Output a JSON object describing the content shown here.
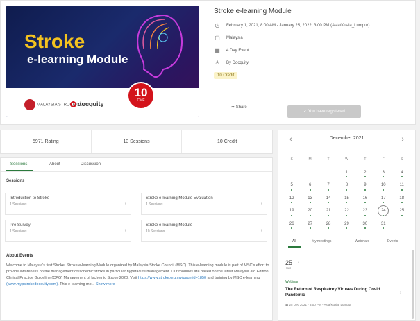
{
  "event": {
    "banner_title": "Stroke",
    "banner_subtitle": "e-learning Module",
    "banner_credit_number": "10",
    "banner_credit_unit": "CME",
    "banner_org": "MALAYSIA STROKE COUNCIL",
    "banner_partner": "docquity",
    "title": "Stroke e-learning Module",
    "date": "February 1, 2021, 8:00 AM - January 25, 2022, 3:00 PM (Asia/Kuala_Lumpur)",
    "location": "Malaysia",
    "duration": "4 Day Event",
    "organizer": "By Docquity",
    "credit": "10 Credit",
    "share_label": "Share",
    "register_label": "You have registered"
  },
  "stats": {
    "rating": "5971 Rating",
    "sessions": "13 Sessions",
    "credits": "10 Credit"
  },
  "tabs": [
    "Sessions",
    "About",
    "Discussion"
  ],
  "sessions_heading": "Sessions",
  "sessions": [
    {
      "title": "Introduction to Stroke",
      "sub": "1 Sessions"
    },
    {
      "title": "Stroke e-learning Module Evaluation",
      "sub": "1 Sessions"
    },
    {
      "title": "Pre Survey",
      "sub": "1 Sessions"
    },
    {
      "title": "Stroke e-learning Module",
      "sub": "10 Sessions"
    }
  ],
  "about": {
    "heading": "About Events",
    "text": "Welcome to Malaysia's first Stroke: Stroke e-learning Module organized by Malaysia Stroke Council (MSC). This e-learning module is part of MSC's effort to provide awareness on the management of ischemic stroke in particular hyperacute management. Our modules are based on the latest Malaysia 3rd Edition Clinical Practice Guideline (CPG) Management of Ischemic Stroke 2020. Visit",
    "link1": "https://www.stroke.org.my/page.id=1850",
    "text2": "and training by MSC e-learning",
    "link2": "(www.mypstrokedocquity.com)",
    "text3": ". This e-learning mo...",
    "more": "Show more"
  },
  "calendar": {
    "month": "December 2021",
    "dow": [
      "S",
      "M",
      "T",
      "W",
      "T",
      "F",
      "S"
    ],
    "weeks": [
      [
        "",
        "",
        "",
        "1",
        "2",
        "3",
        "4"
      ],
      [
        "5",
        "6",
        "7",
        "8",
        "9",
        "10",
        "11"
      ],
      [
        "12",
        "13",
        "14",
        "15",
        "16",
        "17",
        "18"
      ],
      [
        "19",
        "20",
        "21",
        "22",
        "23",
        "24",
        "25"
      ],
      [
        "26",
        "27",
        "28",
        "29",
        "30",
        "31",
        ""
      ]
    ],
    "today": "24",
    "filter_tabs": [
      "All",
      "My meetings",
      "Webinars",
      "Events"
    ],
    "day_number": "25",
    "day_name": "Sat"
  },
  "event_item": {
    "type": "Webinar",
    "title": "The Return of Respiratory Viruses During Covid Pandemic",
    "meta": "25 Dec 2021 - 3:00 PM - Asia/Kuala_Lumpur"
  },
  "colors": {
    "accent": "#2b7a3d",
    "banner_yellow": "#f4c21f",
    "badge_red": "#d3131b"
  }
}
